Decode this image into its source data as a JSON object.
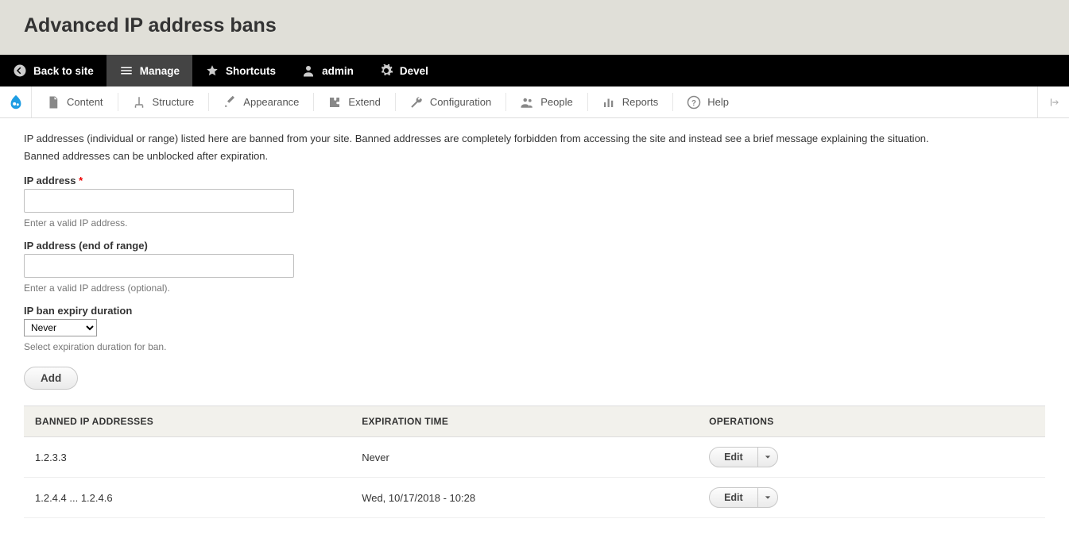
{
  "page": {
    "title": "Advanced IP address bans"
  },
  "toolbar": {
    "back": "Back to site",
    "manage": "Manage",
    "shortcuts": "Shortcuts",
    "admin": "admin",
    "devel": "Devel"
  },
  "admin_menu": {
    "content": "Content",
    "structure": "Structure",
    "appearance": "Appearance",
    "extend": "Extend",
    "configuration": "Configuration",
    "people": "People",
    "reports": "Reports",
    "help": "Help"
  },
  "intro": {
    "line1": "IP addresses (individual or range) listed here are banned from your site. Banned addresses are completely forbidden from accessing the site and instead see a brief message explaining the situation.",
    "line2": "Banned addresses can be unblocked after expiration."
  },
  "form": {
    "ip_label": "IP address",
    "ip_value": "",
    "ip_desc": "Enter a valid IP address.",
    "ip_end_label": "IP address (end of range)",
    "ip_end_value": "",
    "ip_end_desc": "Enter a valid IP address (optional).",
    "expiry_label": "IP ban expiry duration",
    "expiry_value": "Never",
    "expiry_desc": "Select expiration duration for ban.",
    "submit_label": "Add"
  },
  "table": {
    "headers": {
      "ip": "BANNED IP ADDRESSES",
      "exp": "EXPIRATION TIME",
      "ops": "OPERATIONS"
    },
    "rows": [
      {
        "ip": "1.2.3.3",
        "exp": "Never",
        "op": "Edit"
      },
      {
        "ip": "1.2.4.4 ... 1.2.4.6",
        "exp": "Wed, 10/17/2018 - 10:28",
        "op": "Edit"
      }
    ]
  }
}
